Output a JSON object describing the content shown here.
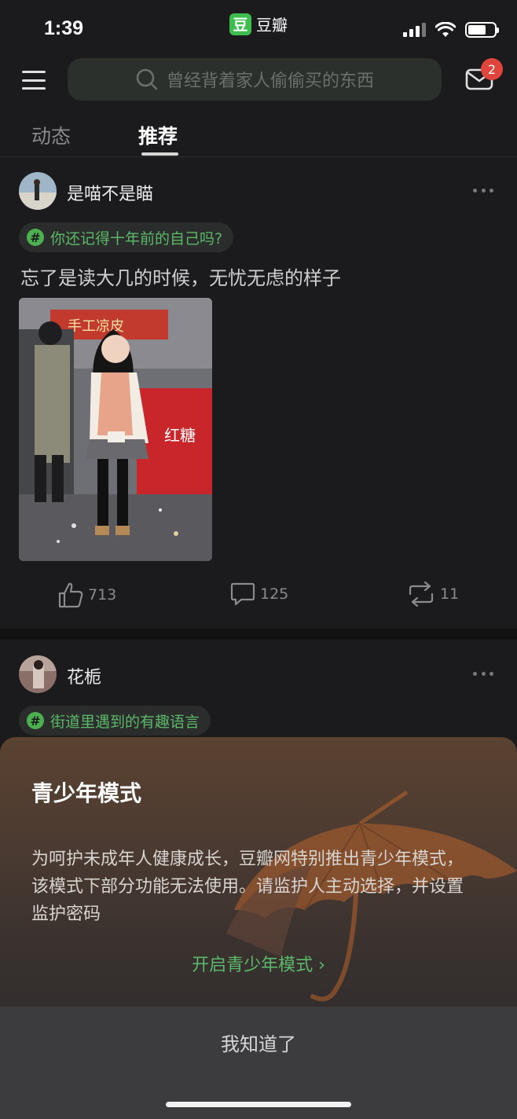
{
  "status_bar": {
    "time": "1:39",
    "app_logo": "豆",
    "app_name": "豆瓣",
    "battery_level": 0.7
  },
  "header": {
    "search_placeholder": "曾经背着家人偷偷买的东西",
    "mail_badge": "2"
  },
  "tabs": [
    {
      "label": "动态",
      "active": false
    },
    {
      "label": "推荐",
      "active": true
    }
  ],
  "posts": [
    {
      "username": "是喵不是瞄",
      "topic": "你还记得十年前的自己吗?",
      "text": "忘了是读大几的时候，无忧无虑的样子",
      "image_sign": "手工凉皮",
      "image_sign2": "红糖",
      "likes": "713",
      "comments": "125",
      "reposts": "11"
    },
    {
      "username": "花栀",
      "topic": "街道里遇到的有趣语言"
    }
  ],
  "youth_mode": {
    "title": "青少年模式",
    "body": "为呵护未成年人健康成长，豆瓣网特别推出青少年模式，该模式下部分功能无法使用。请监护人主动选择，并设置监护密码",
    "enable_link": "开启青少年模式",
    "dismiss": "我知道了"
  },
  "colors": {
    "accent": "#5cb869",
    "badge": "#e0453d",
    "background": "#1b1b1d"
  }
}
